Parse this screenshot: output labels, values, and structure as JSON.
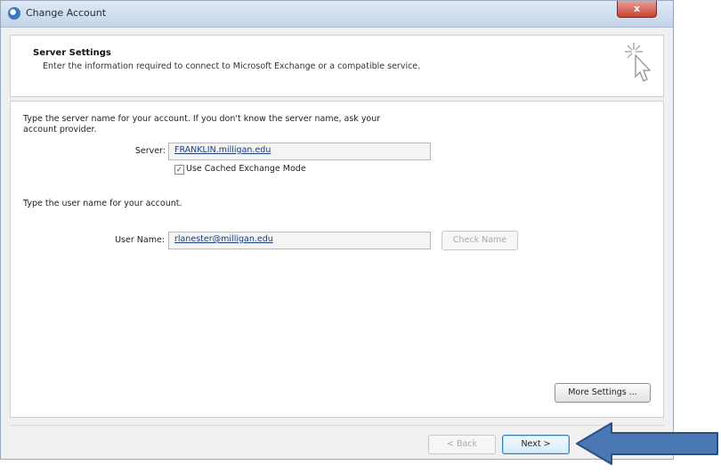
{
  "window": {
    "title": "Change Account",
    "close_label": "x"
  },
  "header": {
    "title": "Server Settings",
    "description": "Enter the information required to connect to Microsoft Exchange or a compatible service."
  },
  "server_section": {
    "instruction": "Type the server name for your account. If you don't know the server name, ask your account provider.",
    "server_label": "Server:",
    "server_value": "FRANKLIN.milligan.edu",
    "cached_mode_label": "Use Cached Exchange Mode",
    "cached_mode_checked": true
  },
  "user_section": {
    "instruction": "Type the user name for your account.",
    "user_label": "User Name:",
    "user_value": "rlanester@milligan.edu",
    "check_name_label": "Check Name"
  },
  "buttons": {
    "more_settings": "More Settings ...",
    "back": "< Back",
    "next": "Next >"
  },
  "colors": {
    "arrow": "#4a78b5",
    "arrow_border": "#2d4f80"
  }
}
